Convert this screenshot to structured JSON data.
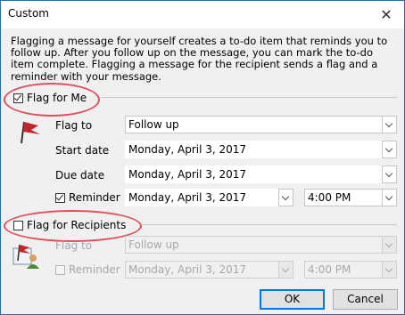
{
  "window": {
    "title": "Custom"
  },
  "description": "Flagging a message for yourself creates a to-do item that reminds you to follow up. After you follow up on the message, you can mark the to-do item complete. Flagging a message for the recipient sends a flag and a reminder with your message.",
  "flag_for_me": {
    "label": "Flag for Me",
    "checked": true,
    "flag_to_label": "Flag to",
    "flag_to_value": "Follow up",
    "start_date_label": "Start date",
    "start_date_value": "Monday, April 3, 2017",
    "due_date_label": "Due date",
    "due_date_value": "Monday, April 3, 2017",
    "reminder_label": "Reminder",
    "reminder_checked": true,
    "reminder_date": "Monday, April 3, 2017",
    "reminder_time": "4:00 PM"
  },
  "flag_for_recipients": {
    "label": "Flag for Recipients",
    "checked": false,
    "flag_to_label": "Flag to",
    "flag_to_value": "Follow up",
    "reminder_label": "Reminder",
    "reminder_checked": false,
    "reminder_date": "Monday, April 3, 2017",
    "reminder_time": "4:00 PM"
  },
  "buttons": {
    "ok": "OK",
    "cancel": "Cancel"
  },
  "colors": {
    "accent": "#0078d7",
    "highlight": "#e0505a",
    "flag": "#c0272d"
  },
  "icons": [
    "close-icon",
    "red-flag-icon",
    "recipient-flag-icon",
    "chevron-down-icon"
  ]
}
